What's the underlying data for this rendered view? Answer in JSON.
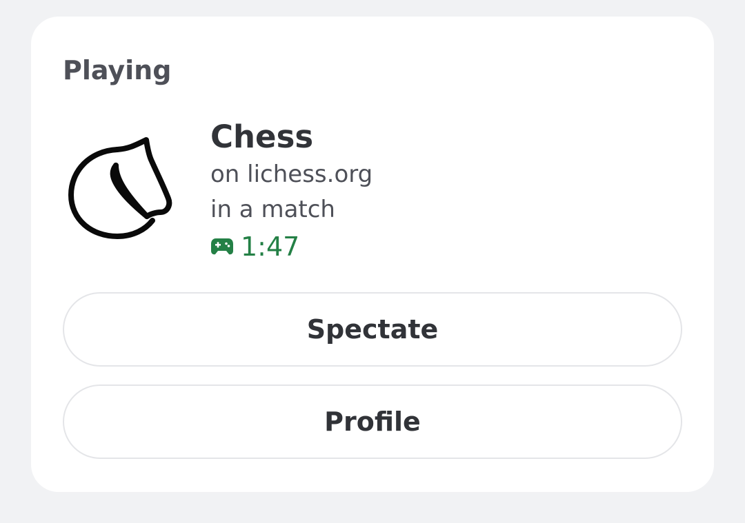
{
  "section_label": "Playing",
  "activity": {
    "name": "Chess",
    "details": "on lichess.org",
    "state": "in a match",
    "elapsed": "1:47",
    "icon": "lichess-horse-icon",
    "elapsed_icon": "gamepad-icon"
  },
  "buttons": {
    "spectate_label": "Spectate",
    "profile_label": "Profile"
  },
  "colors": {
    "elapsed_green": "#248046",
    "background": "#f1f2f4",
    "card": "#ffffff"
  }
}
